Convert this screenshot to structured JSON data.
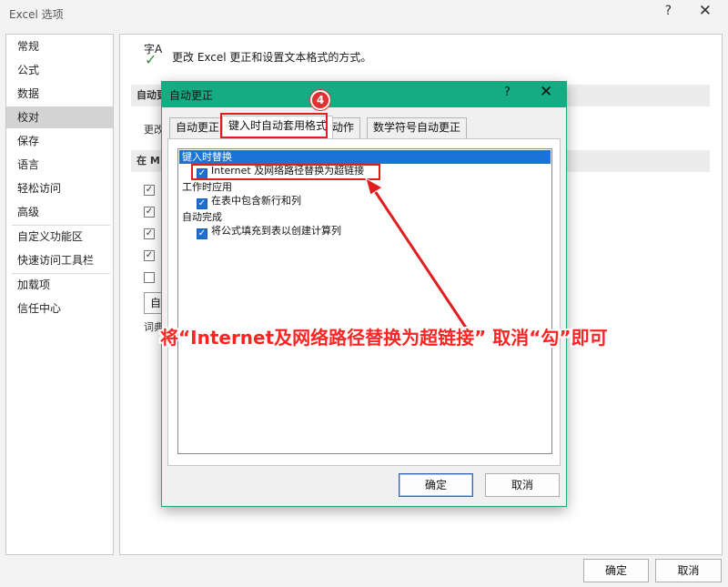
{
  "window": {
    "title": "Excel 选项",
    "help": "?",
    "close": "✕"
  },
  "sidebar": {
    "items": [
      {
        "label": "常规"
      },
      {
        "label": "公式"
      },
      {
        "label": "数据"
      },
      {
        "label": "校对"
      },
      {
        "label": "保存"
      },
      {
        "label": "语言"
      },
      {
        "label": "轻松访问"
      },
      {
        "label": "高级"
      },
      {
        "label": "自定义功能区"
      },
      {
        "label": "快速访问工具栏"
      },
      {
        "label": "加载项"
      },
      {
        "label": "信任中心"
      }
    ],
    "selected": "校对"
  },
  "content": {
    "icon_text": "字A",
    "description": "更改 Excel 更正和设置文本格式的方式。",
    "section1": "自动更",
    "section1_text": "更改",
    "section2": "在 M",
    "button_partial": "自",
    "bottom_text": "词典"
  },
  "footer": {
    "ok": "确定",
    "cancel": "取消"
  },
  "dialog": {
    "title": "自动更正",
    "help": "?",
    "close": "✕",
    "step_number": "4",
    "tabs": [
      {
        "label": "自动更正"
      },
      {
        "label": "键入时自动套用格式"
      },
      {
        "label": "动作"
      },
      {
        "label": "数学符号自动更正"
      }
    ],
    "selected_tab": "键入时自动套用格式",
    "list": {
      "selected_header": "键入时替换",
      "item1": "Internet 及网络路径替换为超链接",
      "group2": "工作时应用",
      "item2": "在表中包含新行和列",
      "group3": "自动完成",
      "item3": "将公式填充到表以创建计算列"
    },
    "ok": "确定",
    "cancel": "取消"
  },
  "annotation": "将“Internet及网络路径替换为超链接” 取消“勾”即可",
  "colors": {
    "accent": "#16ac83",
    "annotation": "#e01e1e",
    "selection": "#1a73d6"
  }
}
